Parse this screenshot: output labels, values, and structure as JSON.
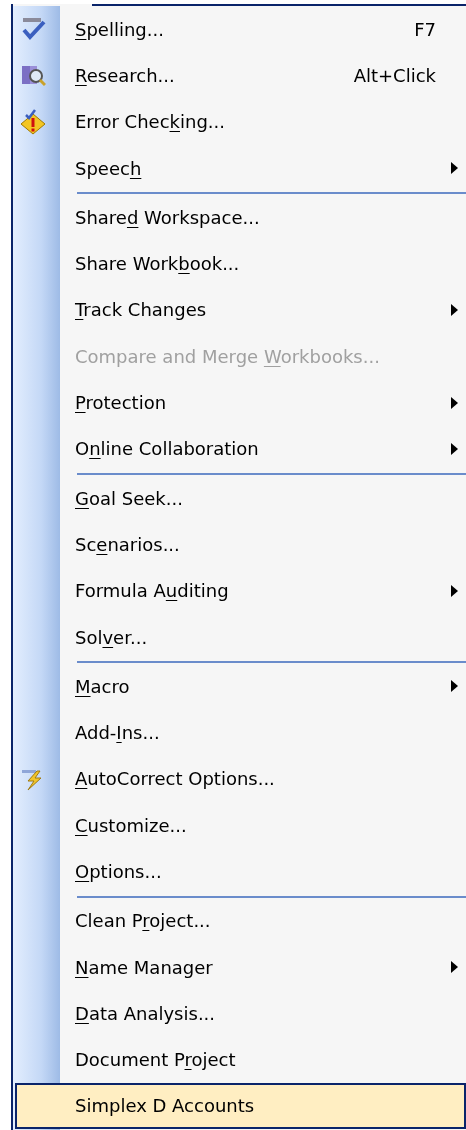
{
  "menu": {
    "groups": [
      [
        {
          "label_parts": {
            "underlined": "S",
            "after": "pelling..."
          },
          "shortcut": "F7",
          "kind": "check",
          "submenu": false,
          "disabled": false,
          "selected": false
        },
        {
          "label_parts": {
            "underlined": "R",
            "after": "esearch..."
          },
          "shortcut": "Alt+Click",
          "kind": "book-magnifier",
          "submenu": false,
          "disabled": false,
          "selected": false
        },
        {
          "label_parts": {
            "before": "Error Chec",
            "underlined": "k",
            "after": "ing..."
          },
          "kind": "warning",
          "submenu": false,
          "disabled": false,
          "selected": false
        },
        {
          "label_parts": {
            "before": "Speec",
            "underlined": "h"
          },
          "submenu": true,
          "disabled": false,
          "selected": false
        }
      ],
      [
        {
          "label_parts": {
            "before": "Share",
            "underlined": "d",
            "after": " Workspace..."
          },
          "submenu": false,
          "disabled": false,
          "selected": false
        },
        {
          "label_parts": {
            "before": "Share Work",
            "underlined": "b",
            "after": "ook..."
          },
          "submenu": false,
          "disabled": false,
          "selected": false
        },
        {
          "label_parts": {
            "underlined": "T",
            "after": "rack Changes"
          },
          "submenu": true,
          "disabled": false,
          "selected": false
        },
        {
          "label_parts": {
            "before": "Compare and Merge ",
            "underlined": "W",
            "after": "orkbooks..."
          },
          "submenu": false,
          "disabled": true,
          "selected": false
        },
        {
          "label_parts": {
            "underlined": "P",
            "after": "rotection"
          },
          "submenu": true,
          "disabled": false,
          "selected": false
        },
        {
          "label_parts": {
            "before": "O",
            "underlined": "n",
            "after": "line Collaboration"
          },
          "submenu": true,
          "disabled": false,
          "selected": false
        }
      ],
      [
        {
          "label_parts": {
            "underlined": "G",
            "after": "oal Seek..."
          },
          "submenu": false,
          "disabled": false,
          "selected": false
        },
        {
          "label_parts": {
            "before": "Sc",
            "underlined": "e",
            "after": "narios..."
          },
          "submenu": false,
          "disabled": false,
          "selected": false
        },
        {
          "label_parts": {
            "before": "Formula A",
            "underlined": "u",
            "after": "diting"
          },
          "submenu": true,
          "disabled": false,
          "selected": false
        },
        {
          "label_parts": {
            "before": "Sol",
            "underlined": "v",
            "after": "er..."
          },
          "submenu": false,
          "disabled": false,
          "selected": false
        }
      ],
      [
        {
          "label_parts": {
            "underlined": "M",
            "after": "acro"
          },
          "submenu": true,
          "disabled": false,
          "selected": false
        },
        {
          "label_parts": {
            "before": "Add-",
            "underlined": "I",
            "after": "ns..."
          },
          "submenu": false,
          "disabled": false,
          "selected": false
        },
        {
          "label_parts": {
            "underlined": "A",
            "after": "utoCorrect Options..."
          },
          "kind": "lightning",
          "submenu": false,
          "disabled": false,
          "selected": false
        },
        {
          "label_parts": {
            "underlined": "C",
            "after": "ustomize..."
          },
          "submenu": false,
          "disabled": false,
          "selected": false
        },
        {
          "label_parts": {
            "underlined": "O",
            "after": "ptions..."
          },
          "submenu": false,
          "disabled": false,
          "selected": false
        }
      ],
      [
        {
          "label_parts": {
            "before": "Clean P",
            "underlined": "r",
            "after": "oject..."
          },
          "submenu": false,
          "disabled": false,
          "selected": false
        },
        {
          "label_parts": {
            "underlined": "N",
            "after": "ame Manager"
          },
          "submenu": true,
          "disabled": false,
          "selected": false
        },
        {
          "label_parts": {
            "underlined": "D",
            "after": "ata Analysis..."
          },
          "submenu": false,
          "disabled": false,
          "selected": false
        },
        {
          "label_parts": {
            "before": "Document P",
            "underlined": "r",
            "after": "oject"
          },
          "submenu": false,
          "disabled": false,
          "selected": false
        },
        {
          "label_parts": {
            "before": "Simplex D Accounts"
          },
          "submenu": false,
          "disabled": false,
          "selected": true
        }
      ]
    ]
  }
}
